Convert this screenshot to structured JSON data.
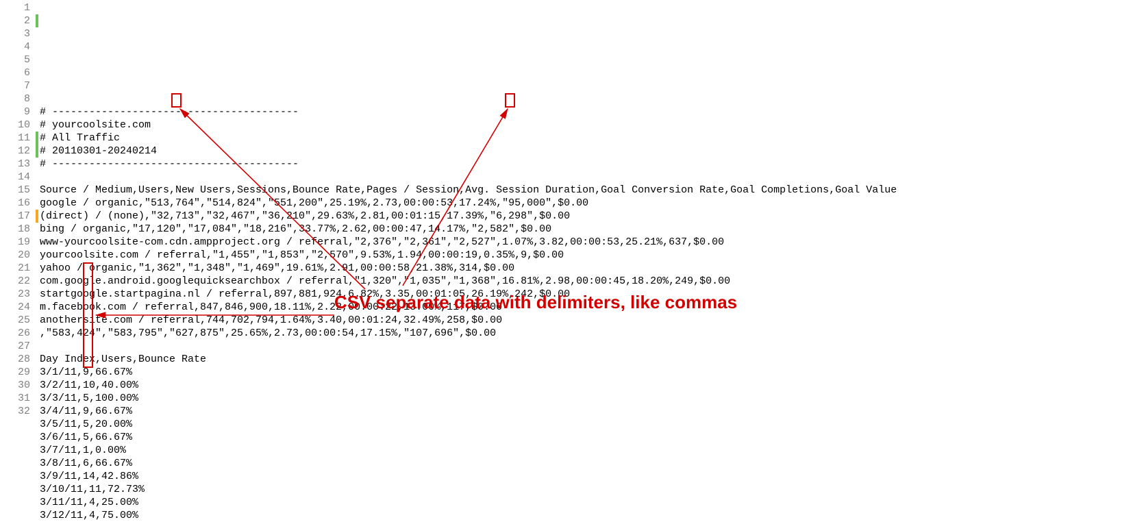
{
  "lines": [
    {
      "n": 1,
      "mark": "",
      "text": "# ----------------------------------------"
    },
    {
      "n": 2,
      "mark": "green",
      "text": "# yourcoolsite.com"
    },
    {
      "n": 3,
      "mark": "",
      "text": "# All Traffic"
    },
    {
      "n": 4,
      "mark": "",
      "text": "# 20110301-20240214"
    },
    {
      "n": 5,
      "mark": "",
      "text": "# ----------------------------------------"
    },
    {
      "n": 6,
      "mark": "",
      "text": ""
    },
    {
      "n": 7,
      "mark": "",
      "text": "Source / Medium,Users,New Users,Sessions,Bounce Rate,Pages / Session,Avg. Session Duration,Goal Conversion Rate,Goal Completions,Goal Value"
    },
    {
      "n": 8,
      "mark": "",
      "text": "google / organic,\"513,764\",\"514,824\",\"551,200\",25.19%,2.73,00:00:53,17.24%,\"95,000\",$0.00"
    },
    {
      "n": 9,
      "mark": "",
      "text": "(direct) / (none),\"32,713\",\"32,467\",\"36,210\",29.63%,2.81,00:01:15,17.39%,\"6,298\",$0.00"
    },
    {
      "n": 10,
      "mark": "",
      "text": "bing / organic,\"17,120\",\"17,084\",\"18,216\",33.77%,2.62,00:00:47,14.17%,\"2,582\",$0.00"
    },
    {
      "n": 11,
      "mark": "green",
      "text": "www-yourcoolsite-com.cdn.ampproject.org / referral,\"2,376\",\"2,361\",\"2,527\",1.07%,3.82,00:00:53,25.21%,637,$0.00"
    },
    {
      "n": 12,
      "mark": "green",
      "text": "yourcoolsite.com / referral,\"1,455\",\"1,853\",\"2,570\",9.53%,1.94,00:00:19,0.35%,9,$0.00"
    },
    {
      "n": 13,
      "mark": "",
      "text": "yahoo / organic,\"1,362\",\"1,348\",\"1,469\",19.61%,2.91,00:00:58,21.38%,314,$0.00"
    },
    {
      "n": 14,
      "mark": "",
      "text": "com.google.android.googlequicksearchbox / referral,\"1,320\",\"1,035\",\"1,368\",16.81%,2.98,00:00:45,18.20%,249,$0.00"
    },
    {
      "n": 15,
      "mark": "",
      "text": "startgoogle.startpagina.nl / referral,897,881,924,6.82%,3.35,00:01:05,26.19%,242,$0.00"
    },
    {
      "n": 16,
      "mark": "",
      "text": "m.facebook.com / referral,847,846,900,18.11%,2.22,00:00:22,13.00%,117,$0.00"
    },
    {
      "n": 17,
      "mark": "orange",
      "text": "anothersite.com / referral,744,702,794,1.64%,3.40,00:01:24,32.49%,258,$0.00"
    },
    {
      "n": 18,
      "mark": "",
      "text": ",\"583,424\",\"583,795\",\"627,875\",25.65%,2.73,00:00:54,17.15%,\"107,696\",$0.00"
    },
    {
      "n": 19,
      "mark": "",
      "text": ""
    },
    {
      "n": 20,
      "mark": "",
      "text": "Day Index,Users,Bounce Rate"
    },
    {
      "n": 21,
      "mark": "",
      "text": "3/1/11,9,66.67%"
    },
    {
      "n": 22,
      "mark": "",
      "text": "3/2/11,10,40.00%"
    },
    {
      "n": 23,
      "mark": "",
      "text": "3/3/11,5,100.00%"
    },
    {
      "n": 24,
      "mark": "",
      "text": "3/4/11,9,66.67%"
    },
    {
      "n": 25,
      "mark": "",
      "text": "3/5/11,5,20.00%"
    },
    {
      "n": 26,
      "mark": "",
      "text": "3/6/11,5,66.67%"
    },
    {
      "n": 27,
      "mark": "",
      "text": "3/7/11,1,0.00%"
    },
    {
      "n": 28,
      "mark": "",
      "text": "3/8/11,6,66.67%"
    },
    {
      "n": 29,
      "mark": "",
      "text": "3/9/11,14,42.86%"
    },
    {
      "n": 30,
      "mark": "",
      "text": "3/10/11,11,72.73%"
    },
    {
      "n": 31,
      "mark": "",
      "text": "3/11/11,4,25.00%"
    },
    {
      "n": 32,
      "mark": "",
      "text": "3/12/11,4,75.00%"
    }
  ],
  "annotation": {
    "label": "CSV separate data with delimiters, like commas"
  }
}
